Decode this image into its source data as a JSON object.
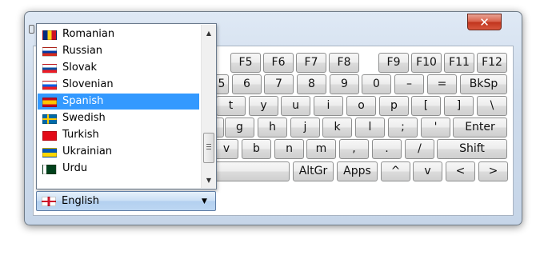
{
  "window": {
    "close_glyph": "✕",
    "accent": "#c0341d"
  },
  "keyboard": {
    "fn_keys": [
      "F5",
      "F6",
      "F7",
      "F8",
      "F9",
      "F10",
      "F11",
      "F12"
    ],
    "number_row": [
      "5",
      "6",
      "7",
      "8",
      "9",
      "0",
      "–",
      "=",
      "BkSp"
    ],
    "top_row": [
      "t",
      "y",
      "u",
      "i",
      "o",
      "p",
      "[",
      "]",
      "\\"
    ],
    "home_row": [
      "g",
      "h",
      "j",
      "k",
      "l",
      ";",
      "'",
      "Enter"
    ],
    "bottom_row": [
      "v",
      "b",
      "n",
      "m",
      ",",
      ".",
      "/",
      "Shift"
    ],
    "space_row": [
      "",
      "AltGr",
      "Apps",
      "^",
      "v",
      "<",
      ">"
    ]
  },
  "language_list": {
    "items": [
      {
        "label": "Romanian",
        "flag": "romania-flag-icon"
      },
      {
        "label": "Russian",
        "flag": "russia-flag-icon"
      },
      {
        "label": "Slovak",
        "flag": "slovakia-flag-icon"
      },
      {
        "label": "Slovenian",
        "flag": "slovenia-flag-icon"
      },
      {
        "label": "Spanish",
        "flag": "spain-flag-icon",
        "selected": true
      },
      {
        "label": "Swedish",
        "flag": "sweden-flag-icon"
      },
      {
        "label": "Turkish",
        "flag": "turkey-flag-icon"
      },
      {
        "label": "Ukrainian",
        "flag": "ukraine-flag-icon"
      },
      {
        "label": "Urdu",
        "flag": "pakistan-flag-icon"
      }
    ],
    "selection_color": "#3399ff"
  },
  "language_select": {
    "value": "English",
    "flag": "uk-flag-icon"
  }
}
